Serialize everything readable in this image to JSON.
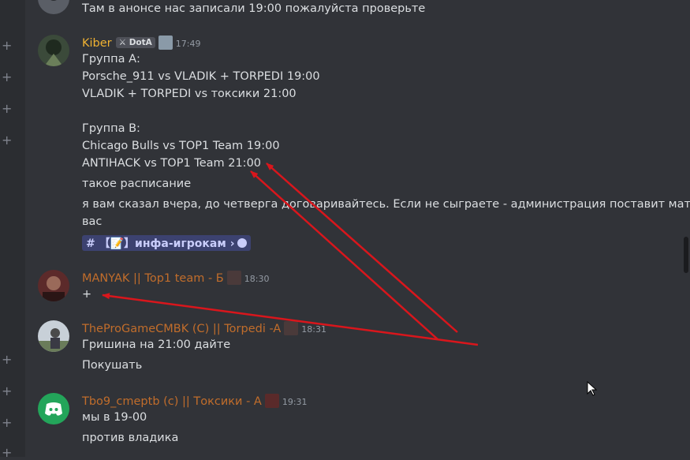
{
  "messages": {
    "top": {
      "text": "Там в анонсе нас записали 19:00 пожалуйста проверьте"
    },
    "kiber": {
      "username": "Kiber",
      "username_color": "#f0b232",
      "tag": "DotA",
      "timestamp": "17:49",
      "lines": [
        "Группа А:",
        "Porsche_911 vs VLADIK + TORPEDI 19:00",
        "VLADIK + TORPEDI vs токсики 21:00",
        "",
        "Группа В:",
        "Chicago Bulls vs TOP1 Team 19:00",
        "ANTIHACK vs TOP1 Team 21:00",
        "такое расписание",
        "я вам сказал вчера, до четверга договаривайтесь. Если не сыграете - администрация поставит матчи за",
        "вас"
      ],
      "channel_link": "# 【📝】инфа-игрокам ›"
    },
    "manyak": {
      "username": "MANYAK || Top1 team - Б",
      "username_color": "#c16d2b",
      "timestamp": "18:30",
      "lines": [
        "+"
      ]
    },
    "theprogame": {
      "username": "TheProGameCMBK (C) || Torpedi -A",
      "username_color": "#c16d2b",
      "timestamp": "18:31",
      "lines": [
        "Гришина на 21:00 дайте",
        "Покушать"
      ]
    },
    "tbo9": {
      "username": "Tbo9_cmeptb (c) || Токсики - A",
      "username_color": "#c16d2b",
      "timestamp": "19:31",
      "lines": [
        "мы в 19-00",
        "против владика"
      ]
    }
  },
  "colors": {
    "arrow": "#d9161c",
    "background": "#313338"
  }
}
